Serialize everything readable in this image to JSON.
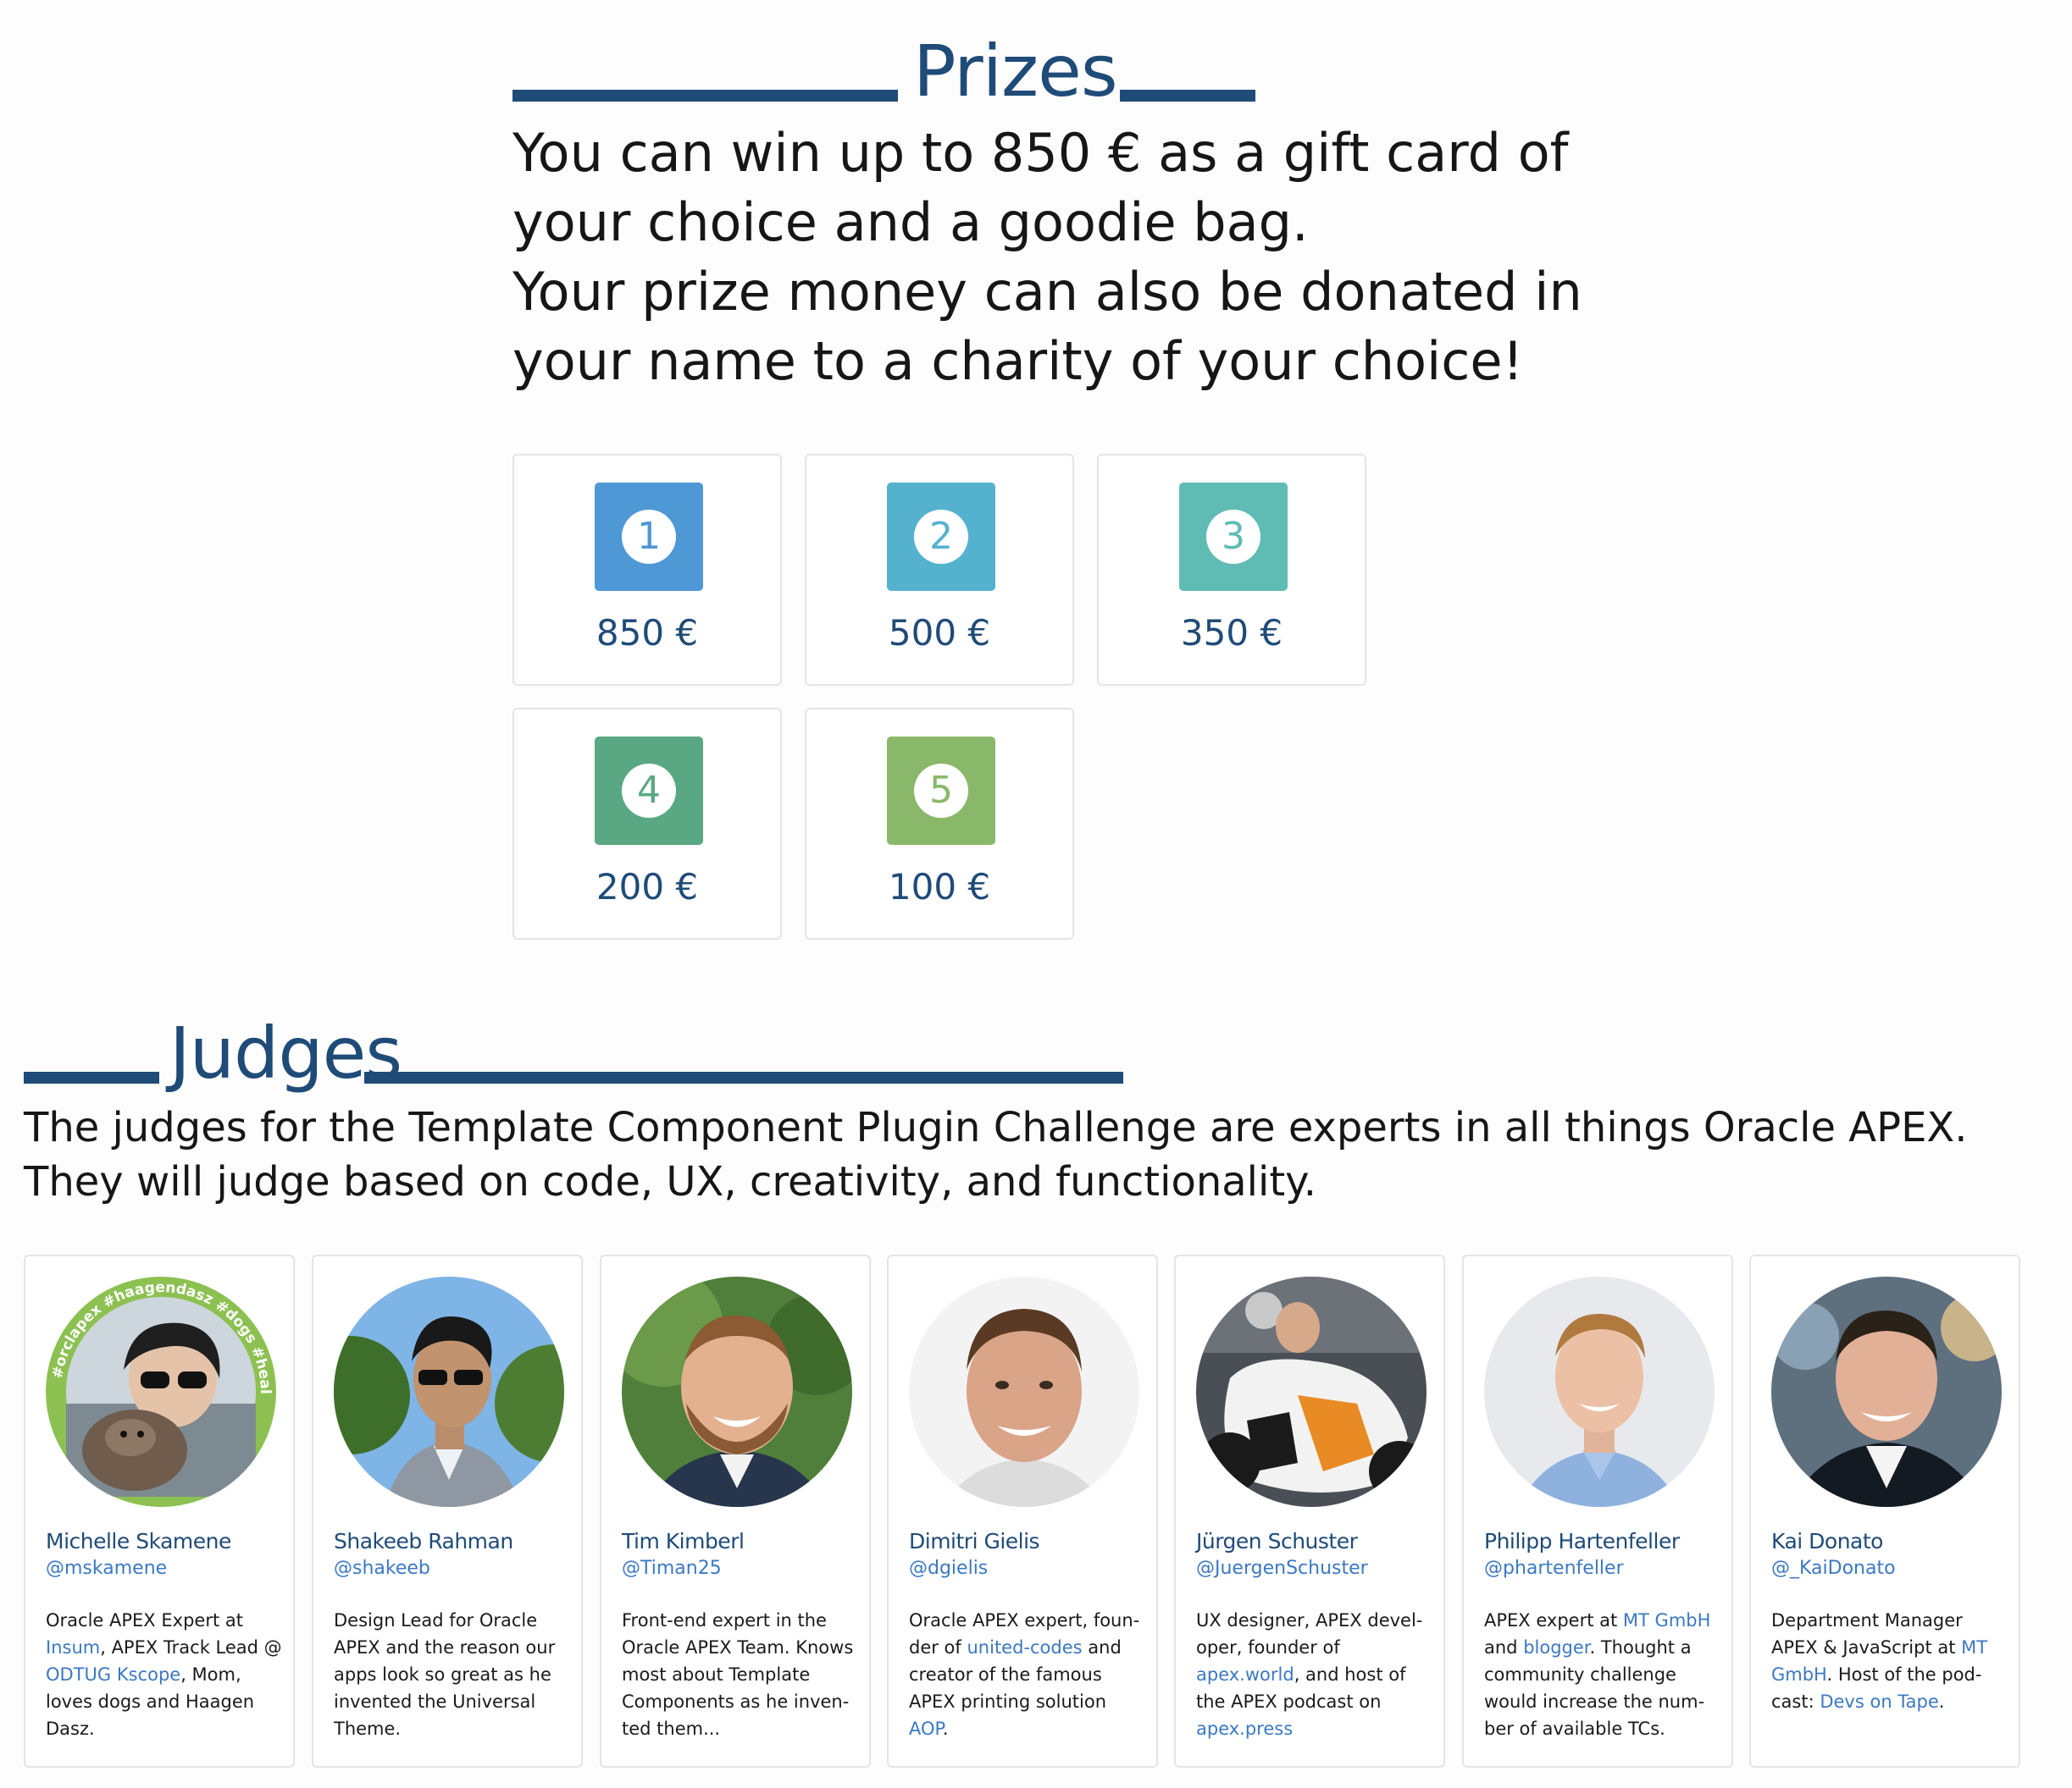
{
  "prizes": {
    "title": "Prizes",
    "intro": [
      "You can win up to 850 € as a gift card of your choice and a goodie bag.",
      "Your prize money can also be donated in your name to a charity of your choice!"
    ],
    "items": [
      {
        "rank": "1",
        "amount": "850 €",
        "color": "#4f98d6"
      },
      {
        "rank": "2",
        "amount": "500 €",
        "color": "#55b2cf"
      },
      {
        "rank": "3",
        "amount": "350 €",
        "color": "#5fbcb4"
      },
      {
        "rank": "4",
        "amount": "200 €",
        "color": "#5aa883"
      },
      {
        "rank": "5",
        "amount": "100 €",
        "color": "#8ab86a"
      }
    ]
  },
  "judges": {
    "title": "Judges",
    "intro": [
      "The judges for the Template Component Plugin Challenge are experts in all things Oracle APEX.",
      "They will judge based on code, UX, creativity, and functionality."
    ],
    "items": [
      {
        "name": "Michelle Skamene",
        "handle": "@mskamene",
        "avatar_ring_text": "#orclapex #haagendasz #dogs #healtheplanet",
        "bio": [
          {
            "t": "Oracle APEX Expert at "
          },
          {
            "t": "Insum",
            "link": true
          },
          {
            "t": ", APEX Track Lead @ "
          },
          {
            "t": "ODTUG Kscope",
            "link": true
          },
          {
            "t": ", Mom, loves dogs and Haagen Dasz."
          }
        ]
      },
      {
        "name": "Shakeeb Rahman",
        "handle": "@shakeeb",
        "bio": [
          {
            "t": "Design Lead for Oracle APEX and the reason our apps look so great as he invented the Universal Theme."
          }
        ]
      },
      {
        "name": "Tim Kimberl",
        "handle": "@Timan25",
        "bio": [
          {
            "t": "Front-end expert in the Oracle APEX Team. Knows most about Template Components as he inven-ted them..."
          }
        ]
      },
      {
        "name": "Dimitri Gielis",
        "handle": "@dgielis",
        "bio": [
          {
            "t": "Oracle APEX expert, foun-der of "
          },
          {
            "t": "united-codes",
            "link": true
          },
          {
            "t": " and creator of the famous APEX printing solution "
          },
          {
            "t": "AOP",
            "link": true
          },
          {
            "t": "."
          }
        ]
      },
      {
        "name": "Jürgen Schuster",
        "handle": "@JuergenSchuster",
        "bio": [
          {
            "t": "UX designer, APEX devel-oper, founder of "
          },
          {
            "t": "apex.world",
            "link": true
          },
          {
            "t": ", and host of the APEX podcast on "
          },
          {
            "t": "apex.press",
            "link": true
          }
        ]
      },
      {
        "name": "Philipp Hartenfeller",
        "handle": "@phartenfeller",
        "bio": [
          {
            "t": "APEX expert at "
          },
          {
            "t": "MT GmbH",
            "link": true
          },
          {
            "t": " and "
          },
          {
            "t": "blogger",
            "link": true
          },
          {
            "t": ". Thought a community challenge would increase the num-ber of available TCs."
          }
        ]
      },
      {
        "name": "Kai Donato",
        "handle": "@_KaiDonato",
        "bio": [
          {
            "t": "Department Manager APEX & JavaScript at "
          },
          {
            "t": "MT GmbH",
            "link": true
          },
          {
            "t": ". Host of the pod-cast: "
          },
          {
            "t": "Devs on Tape",
            "link": true
          },
          {
            "t": "."
          }
        ]
      }
    ]
  }
}
